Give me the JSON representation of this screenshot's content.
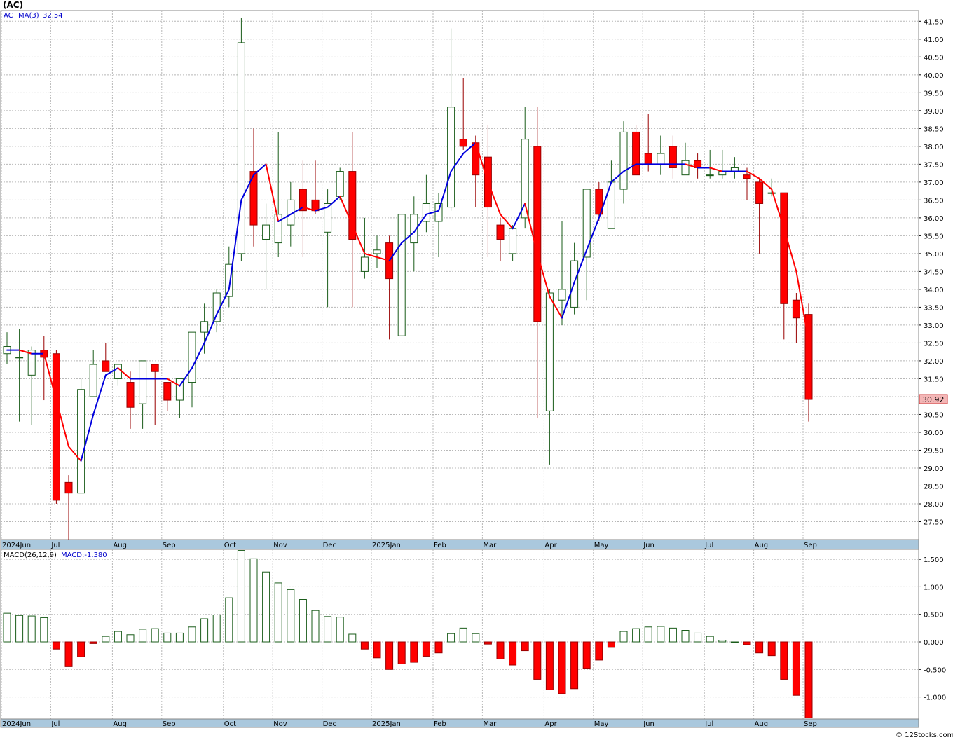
{
  "title": "(AC)",
  "watermark": "© 12Stocks.com",
  "price_panel": {
    "ticker_label": "AC",
    "ma_label": "MA(3)",
    "ma_value": "32.54",
    "last_price": "30.92"
  },
  "macd_panel": {
    "label": "MACD(26,12,9)",
    "value_label": "MACD:-1.380"
  },
  "colors": {
    "up": "#1a5c1a",
    "down": "#ff0000",
    "ma_up": "#0000dd",
    "ma_down": "#ff0000",
    "axis_band": "#aac8dd",
    "grid": "#b8b8b8"
  },
  "chart_data": [
    {
      "type": "candlestick",
      "interval": "weekly",
      "y_ticks": [
        "27.50",
        "28.00",
        "28.50",
        "29.00",
        "29.50",
        "30.00",
        "30.50",
        "31.00",
        "31.50",
        "32.00",
        "32.50",
        "33.00",
        "33.50",
        "34.00",
        "34.50",
        "35.00",
        "35.50",
        "36.00",
        "36.50",
        "37.00",
        "37.50",
        "38.00",
        "38.50",
        "39.00",
        "39.50",
        "40.00",
        "40.50",
        "41.00",
        "41.50"
      ],
      "ylim": [
        27.0,
        41.8
      ],
      "x_ticks": [
        {
          "label": "2024Jun",
          "i": 0
        },
        {
          "label": "Jul",
          "i": 4
        },
        {
          "label": "Aug",
          "i": 9
        },
        {
          "label": "Sep",
          "i": 13
        },
        {
          "label": "Oct",
          "i": 18
        },
        {
          "label": "Nov",
          "i": 22
        },
        {
          "label": "Dec",
          "i": 26
        },
        {
          "label": "2025Jan",
          "i": 30
        },
        {
          "label": "Feb",
          "i": 35
        },
        {
          "label": "Mar",
          "i": 39
        },
        {
          "label": "Apr",
          "i": 44
        },
        {
          "label": "May",
          "i": 48
        },
        {
          "label": "Jun",
          "i": 52
        },
        {
          "label": "Jul",
          "i": 57
        },
        {
          "label": "Aug",
          "i": 61
        },
        {
          "label": "Sep",
          "i": 65
        }
      ],
      "ohlc": [
        [
          32.2,
          32.8,
          31.9,
          32.4
        ],
        [
          32.1,
          32.9,
          30.3,
          32.1
        ],
        [
          31.6,
          32.4,
          30.2,
          32.3
        ],
        [
          32.3,
          32.7,
          30.9,
          32.1
        ],
        [
          32.2,
          32.3,
          28.0,
          28.1
        ],
        [
          28.6,
          28.8,
          27.0,
          28.3
        ],
        [
          28.3,
          31.5,
          28.3,
          31.2
        ],
        [
          31.0,
          32.3,
          31.0,
          31.9
        ],
        [
          32.0,
          32.5,
          31.7,
          31.7
        ],
        [
          31.5,
          31.9,
          31.3,
          31.9
        ],
        [
          31.4,
          31.7,
          30.1,
          30.7
        ],
        [
          30.8,
          32.0,
          30.1,
          32.0
        ],
        [
          31.9,
          31.9,
          30.2,
          31.7
        ],
        [
          31.4,
          31.4,
          30.6,
          30.9
        ],
        [
          30.9,
          31.5,
          30.4,
          31.5
        ],
        [
          31.4,
          32.8,
          30.7,
          32.8
        ],
        [
          32.8,
          33.6,
          32.2,
          33.1
        ],
        [
          33.1,
          34.0,
          32.8,
          33.9
        ],
        [
          33.8,
          35.2,
          33.5,
          34.7
        ],
        [
          35.0,
          41.6,
          34.8,
          40.9
        ],
        [
          37.3,
          38.5,
          35.2,
          35.8
        ],
        [
          35.4,
          36.4,
          34.0,
          35.8
        ],
        [
          35.3,
          38.4,
          34.9,
          36.1
        ],
        [
          35.8,
          37.0,
          35.2,
          36.5
        ],
        [
          36.8,
          37.6,
          34.9,
          36.2
        ],
        [
          36.5,
          37.6,
          36.1,
          36.2
        ],
        [
          35.6,
          36.8,
          33.5,
          36.4
        ],
        [
          36.6,
          37.4,
          36.5,
          37.3
        ],
        [
          37.3,
          38.4,
          33.5,
          35.4
        ],
        [
          34.5,
          36.0,
          34.3,
          34.9
        ],
        [
          35.0,
          35.5,
          34.6,
          35.1
        ],
        [
          35.3,
          35.5,
          32.6,
          34.3
        ],
        [
          32.7,
          35.6,
          32.7,
          36.1
        ],
        [
          35.3,
          36.6,
          34.5,
          36.1
        ],
        [
          35.9,
          37.2,
          35.6,
          36.4
        ],
        [
          35.9,
          36.7,
          34.9,
          36.4
        ],
        [
          36.3,
          41.3,
          36.2,
          39.1
        ],
        [
          38.2,
          39.9,
          37.9,
          38.0
        ],
        [
          38.1,
          38.3,
          36.3,
          37.2
        ],
        [
          37.7,
          38.6,
          34.9,
          36.3
        ],
        [
          35.8,
          36.0,
          34.8,
          35.4
        ],
        [
          35.0,
          35.8,
          34.8,
          35.7
        ],
        [
          36.0,
          39.1,
          35.7,
          38.2
        ],
        [
          38.0,
          39.1,
          30.4,
          33.1
        ],
        [
          30.6,
          34.0,
          29.1,
          33.9
        ],
        [
          33.7,
          35.9,
          33.0,
          34.0
        ],
        [
          33.5,
          35.3,
          33.3,
          34.8
        ],
        [
          34.9,
          36.4,
          33.7,
          36.8
        ],
        [
          36.8,
          37.0,
          35.9,
          36.1
        ],
        [
          35.7,
          37.6,
          35.7,
          37.0
        ],
        [
          36.8,
          38.7,
          36.4,
          38.4
        ],
        [
          38.4,
          38.6,
          37.2,
          37.2
        ],
        [
          37.8,
          38.9,
          37.3,
          37.5
        ],
        [
          37.5,
          38.3,
          37.2,
          37.8
        ],
        [
          38.0,
          38.3,
          37.1,
          37.4
        ],
        [
          37.2,
          38.1,
          37.2,
          37.6
        ],
        [
          37.6,
          37.8,
          37.1,
          37.4
        ],
        [
          37.2,
          37.9,
          37.1,
          37.2
        ],
        [
          37.2,
          37.9,
          37.1,
          37.3
        ],
        [
          37.3,
          37.7,
          37.1,
          37.4
        ],
        [
          37.2,
          37.4,
          36.5,
          37.1
        ],
        [
          37.0,
          37.1,
          35.0,
          36.4
        ],
        [
          36.7,
          37.1,
          36.6,
          36.7
        ],
        [
          36.7,
          36.7,
          32.6,
          33.6
        ],
        [
          33.7,
          33.9,
          32.5,
          33.2
        ],
        [
          33.3,
          33.6,
          30.3,
          30.92
        ]
      ],
      "ma3": [
        32.3,
        32.3,
        32.2,
        32.2,
        30.9,
        29.6,
        29.2,
        30.5,
        31.6,
        31.8,
        31.5,
        31.5,
        31.5,
        31.5,
        31.3,
        31.8,
        32.5,
        33.3,
        34.0,
        36.5,
        37.2,
        37.5,
        35.9,
        36.1,
        36.3,
        36.2,
        36.3,
        36.6,
        35.8,
        35.0,
        34.9,
        34.8,
        35.3,
        35.6,
        36.1,
        36.2,
        37.3,
        37.8,
        38.1,
        37.0,
        36.1,
        35.7,
        36.4,
        35.0,
        33.8,
        33.2,
        34.2,
        35.1,
        36.0,
        37.0,
        37.3,
        37.5,
        37.5,
        37.5,
        37.5,
        37.5,
        37.4,
        37.4,
        37.3,
        37.3,
        37.3,
        37.1,
        36.8,
        35.7,
        34.5,
        32.54
      ],
      "price_label": "30.92"
    },
    {
      "type": "bar",
      "title": "MACD(26,12,9)",
      "y_ticks": [
        "1.500",
        "1.000",
        "0.500",
        "0.000",
        "-0.500",
        "-1.000"
      ],
      "ylim": [
        -1.4,
        1.68
      ],
      "values": [
        0.52,
        0.48,
        0.47,
        0.44,
        -0.13,
        -0.45,
        -0.27,
        -0.03,
        0.1,
        0.19,
        0.13,
        0.23,
        0.24,
        0.16,
        0.16,
        0.27,
        0.42,
        0.49,
        0.8,
        1.66,
        1.51,
        1.27,
        1.07,
        0.95,
        0.77,
        0.57,
        0.46,
        0.45,
        0.14,
        -0.13,
        -0.29,
        -0.5,
        -0.4,
        -0.37,
        -0.26,
        -0.2,
        0.15,
        0.25,
        0.15,
        -0.04,
        -0.31,
        -0.42,
        -0.16,
        -0.68,
        -0.87,
        -0.94,
        -0.85,
        -0.48,
        -0.33,
        -0.1,
        0.19,
        0.24,
        0.27,
        0.28,
        0.25,
        0.21,
        0.16,
        0.1,
        0.03,
        0.0,
        -0.05,
        -0.2,
        -0.25,
        -0.68,
        -0.97,
        -1.38
      ]
    }
  ]
}
